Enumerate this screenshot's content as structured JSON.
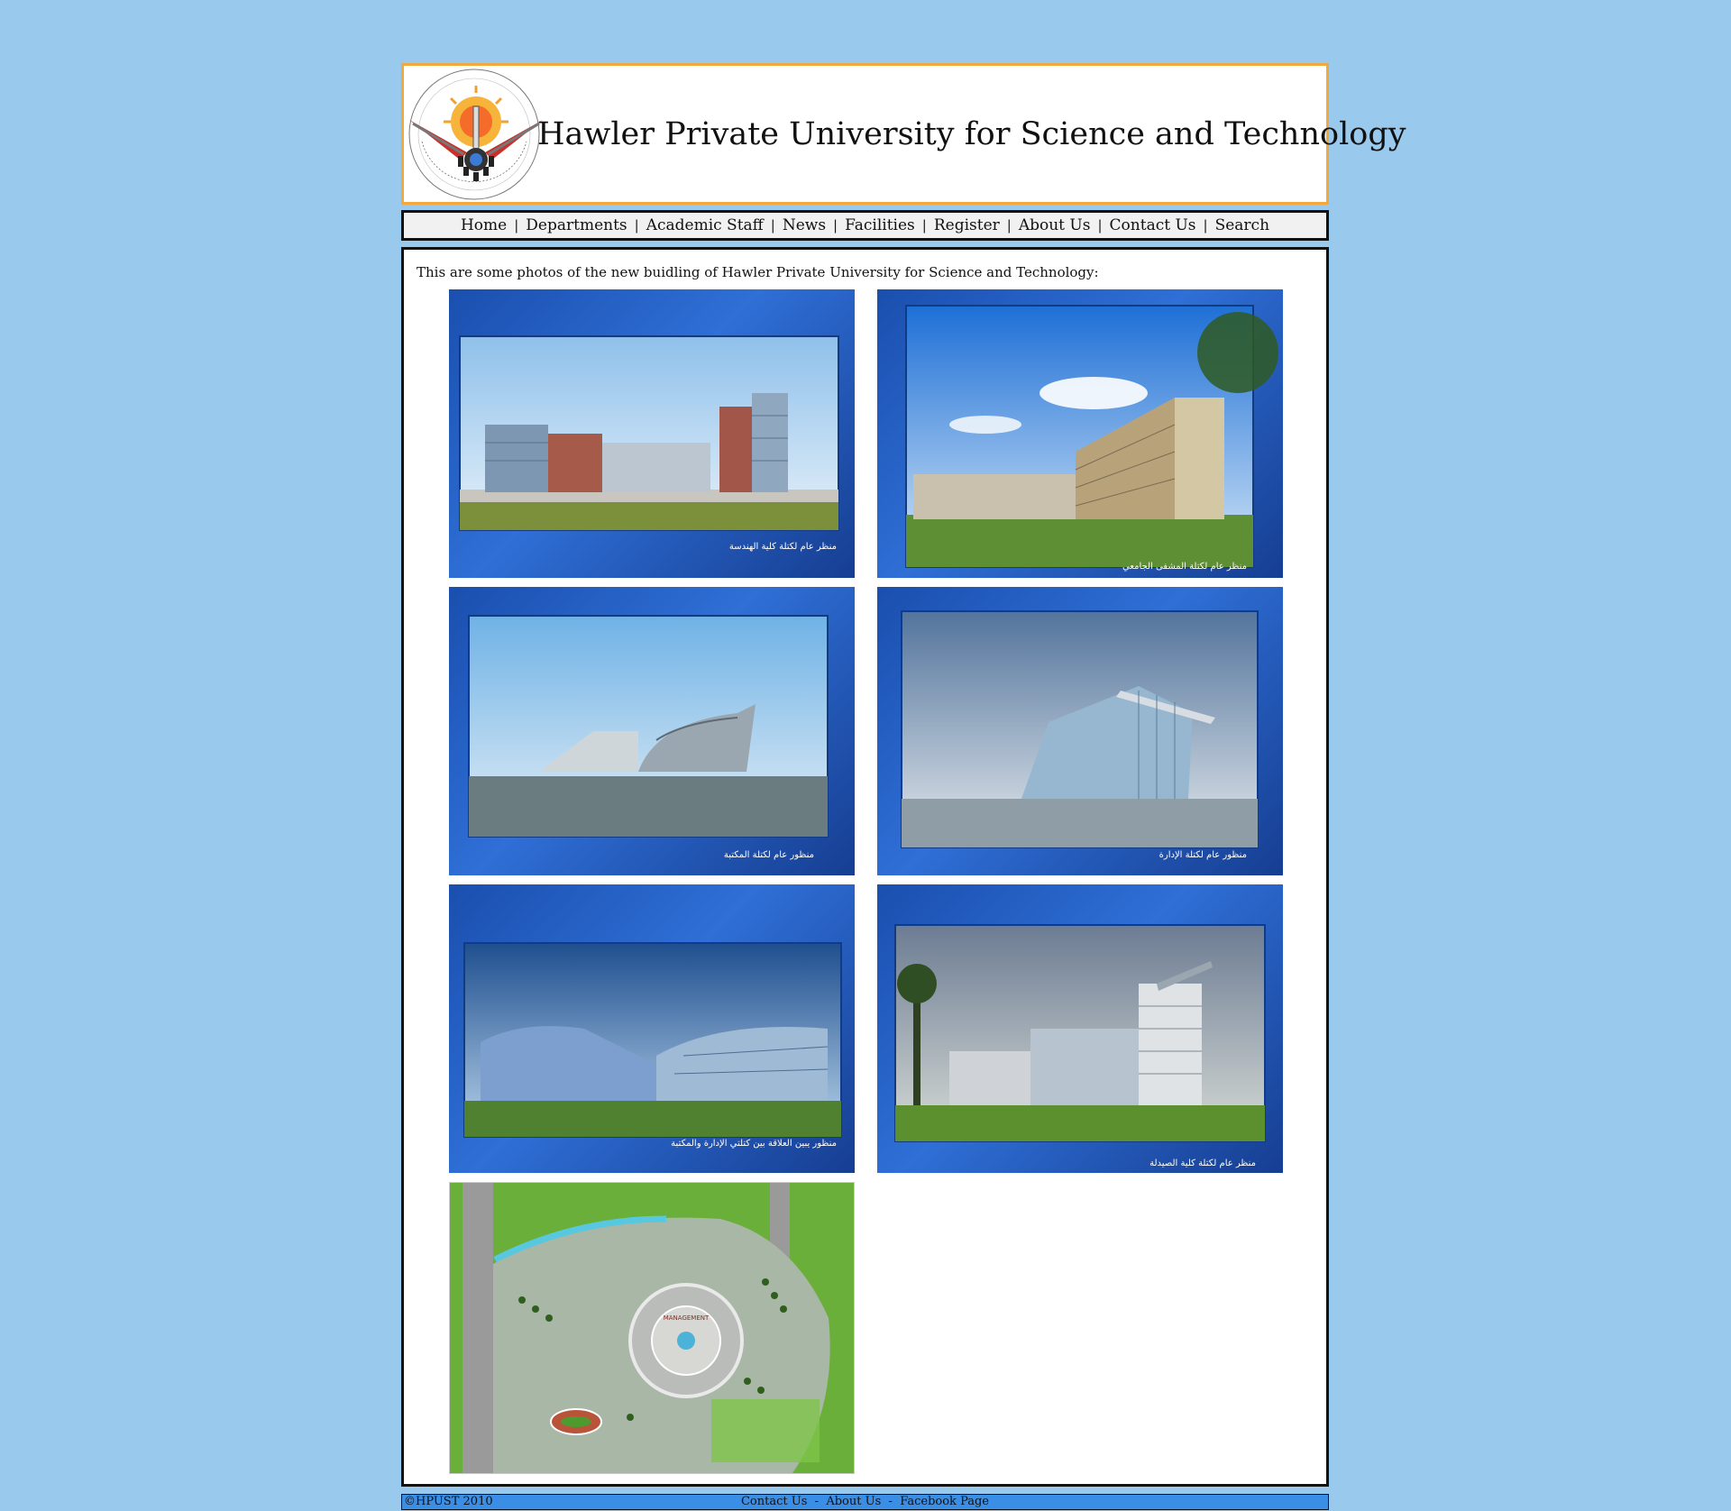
{
  "header": {
    "title": "Hawler Private University for Science and Technology"
  },
  "nav": {
    "items": [
      "Home",
      "Departments",
      "Academic Staff",
      "News",
      "Facilities",
      "Register",
      "About Us",
      "Contact Us",
      "Search"
    ]
  },
  "content": {
    "intro": "This are some photos of the new buidling of Hawler Private University for Science and Technology:",
    "photos": [
      {
        "caption": "منظر عام لكتلة كلية الهندسة"
      },
      {
        "caption": "منظر عام لكتلة المشفى الجامعي"
      },
      {
        "caption": "منظور عام لكتلة المكتبة"
      },
      {
        "caption": "منظور عام لكتلة الإدارة"
      },
      {
        "caption": "منظور يبين العلاقة بين كتلتي الإدارة والمكتبة"
      },
      {
        "caption": "منظر عام لكتلة كلية الصيدلة"
      },
      {
        "caption": "MANAGEMENT"
      }
    ]
  },
  "footer": {
    "copyright": "©HPUST 2010",
    "links": [
      "Contact Us",
      "About Us",
      "Facebook Page"
    ],
    "separator": "-"
  },
  "colors": {
    "page_bg": "#99c9ec",
    "header_border": "#f2a93b",
    "footer_bg": "#3a8ee6"
  }
}
